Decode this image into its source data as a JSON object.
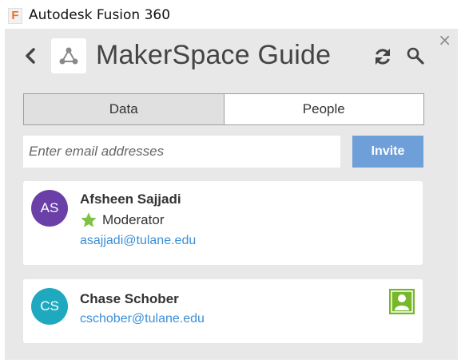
{
  "window": {
    "app_icon_letter": "F",
    "title": "Autodesk Fusion 360",
    "close_glyph": "×"
  },
  "header": {
    "title": "MakerSpace Guide",
    "icons": [
      "back-chevron-icon",
      "fusion-logo-icon",
      "refresh-icon",
      "search-icon"
    ]
  },
  "tabs": [
    {
      "label": "Data",
      "active": true
    },
    {
      "label": "People",
      "active": false
    }
  ],
  "invite": {
    "placeholder": "Enter email addresses",
    "value": "",
    "button_label": "Invite"
  },
  "members": [
    {
      "initials": "AS",
      "name": "Afsheen Sajjadi",
      "role": "Moderator",
      "email": "asajjadi@tulane.edu",
      "avatar_color": "#6a3fa8"
    },
    {
      "initials": "CS",
      "name": "Chase Schober",
      "email": "cschober@tulane.edu",
      "avatar_color": "#1ea9bf"
    }
  ],
  "colors": {
    "accent_blue": "#6f9fd8",
    "link_blue": "#3a8fd6",
    "star_green": "#7dc242",
    "user_icon_green": "#77b82a"
  }
}
